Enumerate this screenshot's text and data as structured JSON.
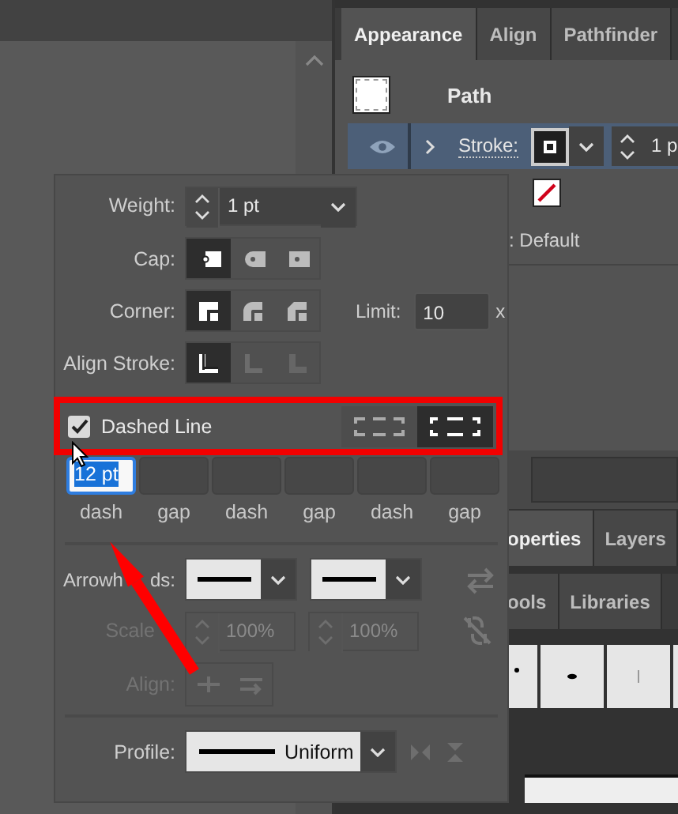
{
  "tabs": [
    {
      "label": "Appearance",
      "selected": true
    },
    {
      "label": "Align",
      "selected": false
    },
    {
      "label": "Pathfinder",
      "selected": false
    }
  ],
  "appearance": {
    "title": "Path",
    "stroke_row": {
      "label": "Stroke:",
      "selected": true,
      "weight": "1 p"
    },
    "opacity_row": {
      "value": ": Default"
    }
  },
  "stroke_panel": {
    "weight": {
      "label": "Weight:",
      "value": "1 pt"
    },
    "cap": {
      "label": "Cap:",
      "options": [
        {
          "kind": "butt",
          "selected": true
        },
        {
          "kind": "round",
          "selected": false
        },
        {
          "kind": "projecting",
          "selected": false
        }
      ]
    },
    "corner": {
      "label": "Corner:",
      "options": [
        {
          "kind": "miter",
          "selected": true
        },
        {
          "kind": "round",
          "selected": false
        },
        {
          "kind": "bevel",
          "selected": false
        }
      ],
      "limit_label": "Limit:",
      "limit": "10",
      "limit_unit": "x"
    },
    "align_stroke": {
      "label": "Align Stroke:",
      "options": [
        {
          "kind": "center",
          "selected": true,
          "disabled": false
        },
        {
          "kind": "inside",
          "selected": false,
          "disabled": true
        },
        {
          "kind": "outside",
          "selected": false,
          "disabled": true
        }
      ]
    },
    "dashed_line": {
      "label": "Dashed Line",
      "checked": true,
      "modes": [
        {
          "kind": "exact",
          "selected": false
        },
        {
          "kind": "adjust",
          "selected": true
        }
      ]
    },
    "dash_pattern": [
      {
        "label": "dash",
        "value": "12 pt",
        "focused": true
      },
      {
        "label": "gap",
        "focused": false
      },
      {
        "label": "dash",
        "focused": false
      },
      {
        "label": "gap",
        "focused": false
      },
      {
        "label": "dash",
        "focused": false
      },
      {
        "label": "gap",
        "focused": false
      }
    ],
    "arrowheads": {
      "label_parts": [
        "Arrowh",
        "ds:"
      ]
    },
    "scale": {
      "label": "Scale",
      "values": [
        "100%",
        "100%"
      ],
      "disabled": true
    },
    "align": {
      "label": "Align:",
      "disabled": true
    },
    "profile": {
      "label": "Profile:",
      "value": "Uniform"
    }
  },
  "lower_tabs": [
    {
      "label": "operties",
      "selected": true
    },
    {
      "label": "Layers",
      "selected": false
    }
  ],
  "library_tabs": [
    {
      "label": "ools",
      "selected": false
    },
    {
      "label": "Libraries",
      "selected": false
    }
  ]
}
